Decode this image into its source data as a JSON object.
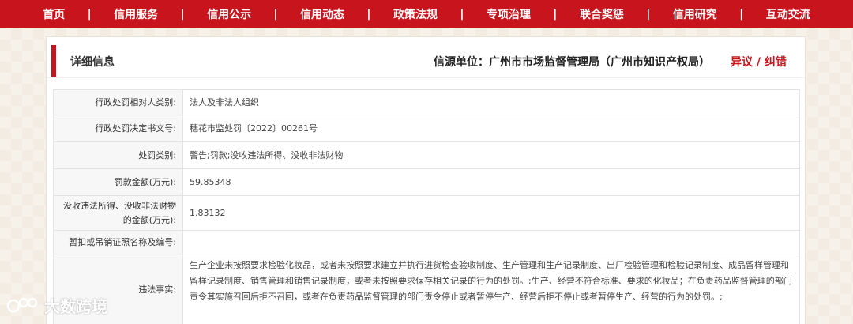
{
  "nav": {
    "items": [
      "首页",
      "信用服务",
      "信用公示",
      "信用动态",
      "政策法规",
      "专项治理",
      "联合奖惩",
      "信用研究",
      "互动交流"
    ],
    "separator": "|"
  },
  "panel": {
    "title": "详细信息",
    "source": "信源单位：广州市市场监督管理局（广州市知识产权局）",
    "objection": "异议 / 纠错"
  },
  "rows": [
    {
      "label": "行政处罚相对人类别:",
      "value": "法人及非法人组织"
    },
    {
      "label": "行政处罚决定书文号:",
      "value": "穗花市监处罚〔2022〕00261号"
    },
    {
      "label": "处罚类别:",
      "value": "警告;罚款;没收违法所得、没收非法财物"
    },
    {
      "label": "罚款金额(万元):",
      "value": "59.85348"
    },
    {
      "label": "没收违法所得、没收非法财物的金额(万元):",
      "value": "1.83132"
    },
    {
      "label": "暂扣或吊销证照名称及编号:",
      "value": ""
    },
    {
      "label": "违法事实:",
      "value": "生产企业未按照要求检验化妆品，或者未按照要求建立并执行进货检查验收制度、生产管理和生产记录制度、出厂检验管理和检验记录制度、成品留样管理和留样记录制度、销售管理和销售记录制度，或者未按照要求保存相关记录的行为的处罚。;生产、经营不符合标准、要求的化妆品；在负责药品监督管理的部门责令其实施召回后拒不召回，或者在负责药品监督管理的部门责令停止或者暂停生产、经营后拒不停止或者暂停生产、经营的行为的处罚。;"
    }
  ],
  "watermark": {
    "text": "大数跨境"
  }
}
